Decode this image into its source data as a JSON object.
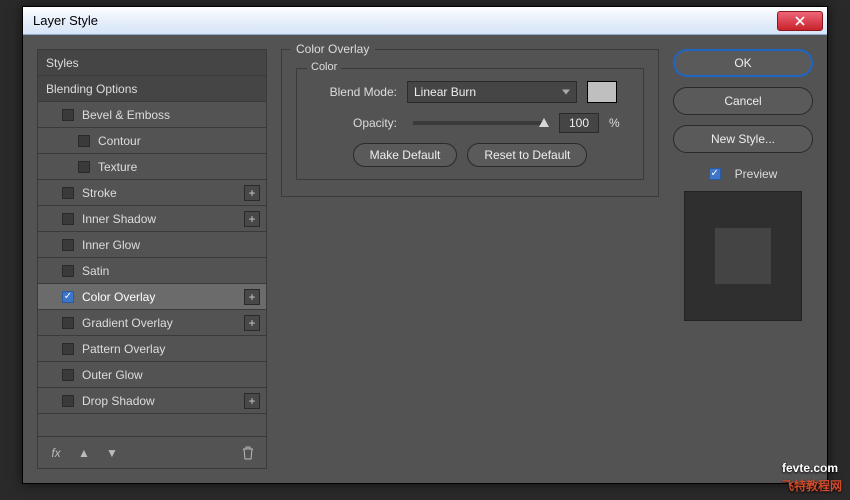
{
  "window": {
    "title": "Layer Style"
  },
  "left": {
    "styles_label": "Styles",
    "blending_label": "Blending Options",
    "items": {
      "bevel": "Bevel & Emboss",
      "contour": "Contour",
      "texture": "Texture",
      "stroke": "Stroke",
      "inner_shadow": "Inner Shadow",
      "inner_glow": "Inner Glow",
      "satin": "Satin",
      "color_overlay": "Color Overlay",
      "gradient_overlay": "Gradient Overlay",
      "pattern_overlay": "Pattern Overlay",
      "outer_glow": "Outer Glow",
      "drop_shadow": "Drop Shadow"
    },
    "fx_label": "fx"
  },
  "center": {
    "group_title": "Color Overlay",
    "inner_title": "Color",
    "blend_mode_label": "Blend Mode:",
    "blend_mode_value": "Linear Burn",
    "color_swatch": "#bfbfbf",
    "opacity_label": "Opacity:",
    "opacity_value": "100",
    "opacity_unit": "%",
    "make_default": "Make Default",
    "reset_default": "Reset to Default"
  },
  "right": {
    "ok": "OK",
    "cancel": "Cancel",
    "new_style": "New Style...",
    "preview": "Preview"
  },
  "watermark": {
    "line1": "fevte.com",
    "line2": "飞特教程网"
  }
}
